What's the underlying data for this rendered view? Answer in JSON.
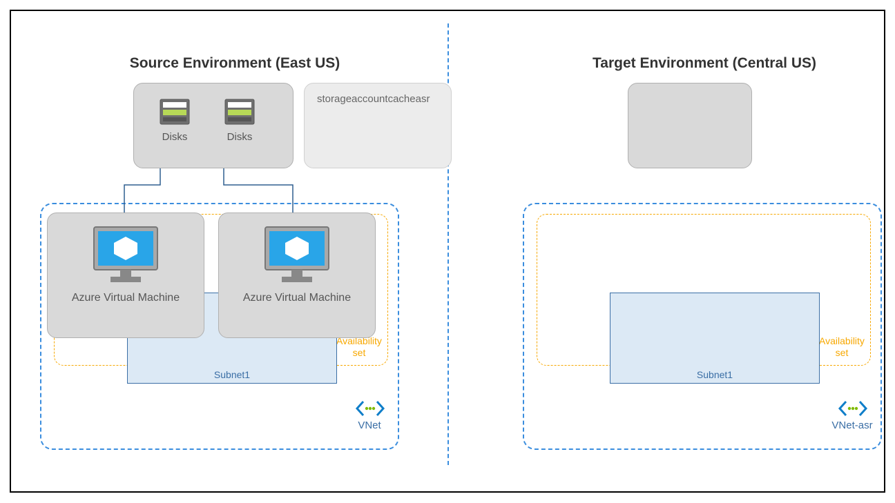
{
  "source": {
    "title": "Source Environment (East US)",
    "disks": {
      "label1": "Disks",
      "label2": "Disks"
    },
    "storageLabel": "storageaccountcacheasr",
    "vm1": "Azure Virtual Machine",
    "vm2": "Azure Virtual Machine",
    "availability": "Availability set",
    "subnet": "Subnet1",
    "vnet": "VNet"
  },
  "target": {
    "title": "Target Environment (Central US)",
    "availability": "Availability set",
    "subnet": "Subnet1",
    "vnet": "VNet-asr"
  }
}
